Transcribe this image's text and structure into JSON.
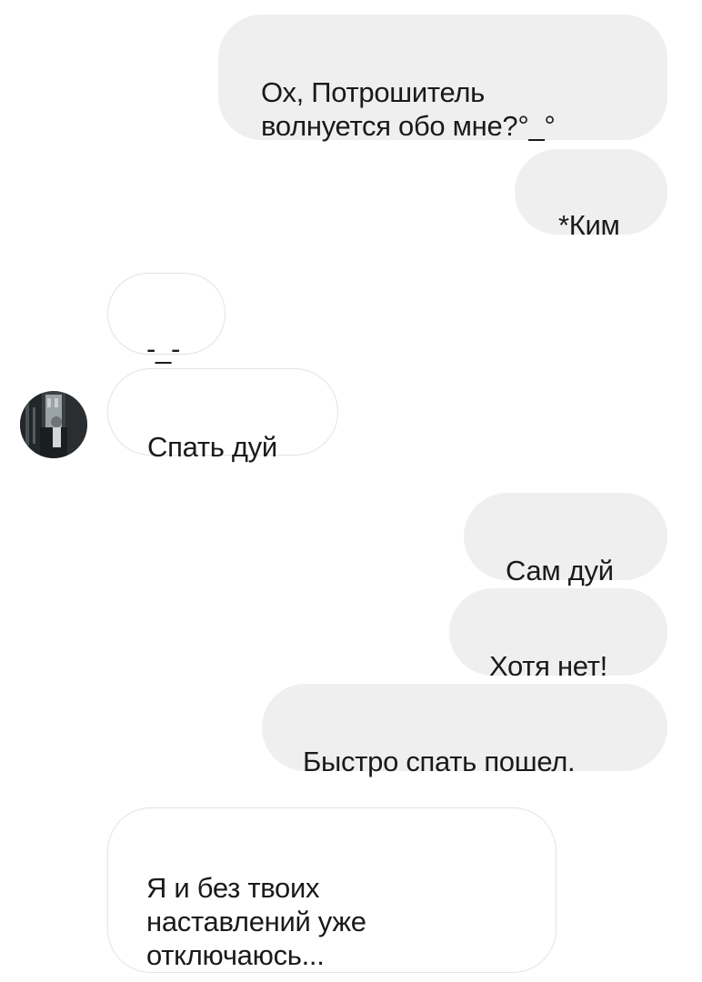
{
  "conversation": {
    "messages": [
      {
        "side": "outgoing",
        "text": "Ох, Потрошитель\nволнуется обо мне?°_°"
      },
      {
        "side": "outgoing",
        "text": "*Ким"
      },
      {
        "side": "incoming",
        "text": "-_-"
      },
      {
        "side": "incoming",
        "text": "Спать дуй",
        "has_avatar": true
      },
      {
        "side": "outgoing",
        "text": "Сам дуй"
      },
      {
        "side": "outgoing",
        "text": "Хотя нет!"
      },
      {
        "side": "outgoing",
        "text": "Быстро спать пошел."
      },
      {
        "side": "incoming",
        "text": "Я и без твоих\nнаставлений уже\nотключаюсь..."
      }
    ],
    "contact_avatar": "contact-photo-avatar"
  },
  "colors": {
    "outgoing_bubble": "#efefef",
    "incoming_border": "#e3e3e3",
    "text": "#1a1a1a",
    "background": "#ffffff"
  }
}
